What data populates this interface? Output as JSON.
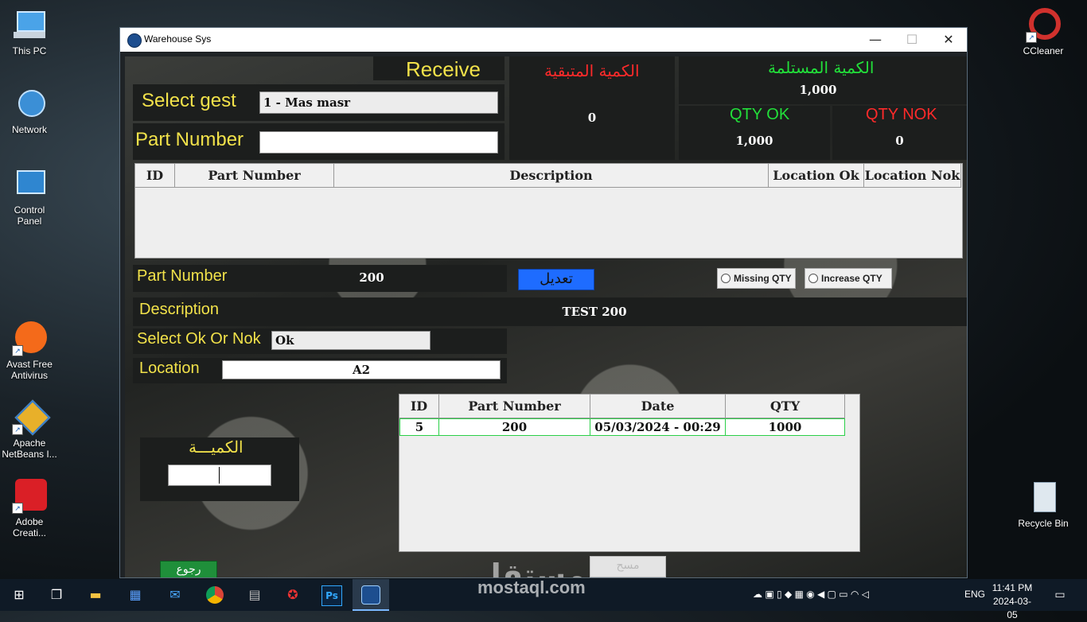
{
  "desktop": {
    "icons_left": [
      {
        "label": "This PC",
        "icon": "computer-icon"
      },
      {
        "label": "Network",
        "icon": "network-icon"
      },
      {
        "label": "Control Panel",
        "icon": "control-panel-icon"
      },
      {
        "label": "Avast Free Antivirus",
        "icon": "avast-icon"
      },
      {
        "label": "Apache NetBeans I...",
        "icon": "netbeans-icon"
      },
      {
        "label": "Adobe Creati...",
        "icon": "adobe-cc-icon"
      }
    ],
    "icons_right": [
      {
        "label": "CCleaner",
        "icon": "ccleaner-icon"
      },
      {
        "label": "Recycle Bin",
        "icon": "recycle-bin-icon"
      }
    ]
  },
  "window": {
    "title": "Warehouse Sys",
    "controls": {
      "minimize": "—",
      "maximize": "☐",
      "close": "✕"
    }
  },
  "form": {
    "receive_title": "Receive",
    "remaining_qty_label": "الكمية المتبقية",
    "remaining_qty_value": "0",
    "received_qty_label": "الكمية المستلمة",
    "received_qty_value": "1,000",
    "qty_ok_label": "QTY OK",
    "qty_ok_value": "1,000",
    "qty_nok_label": "QTY NOK",
    "qty_nok_value": "0",
    "select_gest_label": "Select gest",
    "select_gest_value": "1 - Mas masr",
    "part_number_label": "Part Number",
    "part_number_input": "",
    "items_table": {
      "columns": [
        "ID",
        "Part Number",
        "Description",
        "Location Ok",
        "Location Nok"
      ],
      "rows": []
    },
    "detail_part_number_label": "Part Number",
    "detail_part_number_value": "200",
    "edit_button": "تعديل",
    "missing_qty_label": "Missing QTY",
    "increase_qty_label": "Increase QTY",
    "description_label": "Description",
    "description_value": "TEST 200",
    "select_ok_nok_label": "Select Ok Or Nok",
    "select_ok_nok_value": "Ok",
    "location_label": "Location",
    "location_value": "A2",
    "quantity_label": "الكميـــة",
    "quantity_value": "",
    "history_table": {
      "columns": [
        "ID",
        "Part Number",
        "Date",
        "QTY"
      ],
      "rows": [
        {
          "id": "5",
          "part_number": "200",
          "date": "05/03/2024 - 00:29",
          "qty": "1000"
        }
      ]
    },
    "back_button": "رجوع",
    "delete_button": "مسح"
  },
  "watermark": {
    "brand": "مستقل",
    "url": "mostaql.com"
  },
  "taskbar": {
    "language": "ENG",
    "time": "11:41 PM",
    "date": "2024-03-05"
  },
  "colors": {
    "accent_yellow": "#f2e24a",
    "red_label": "#ff2a2a",
    "green_label": "#22e03a",
    "edit_button_bg": "#1e6cff"
  }
}
